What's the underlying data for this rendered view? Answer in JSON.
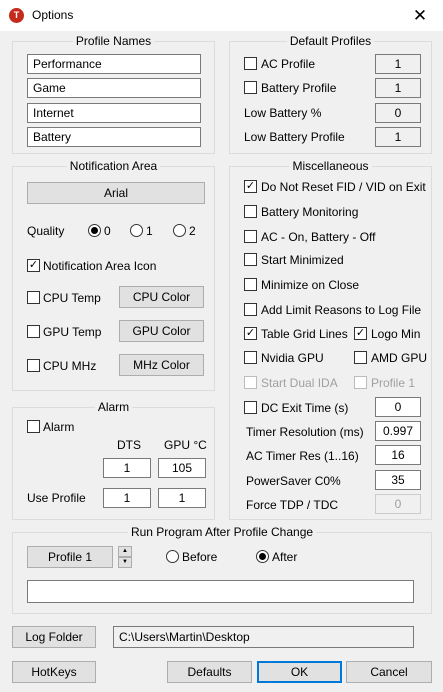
{
  "window": {
    "title": "Options",
    "icon_letter": "T"
  },
  "profile_names": {
    "title": "Profile Names",
    "names": [
      "Performance",
      "Game",
      "Internet",
      "Battery"
    ]
  },
  "default_profiles": {
    "title": "Default Profiles",
    "ac_profile": {
      "label": "AC Profile",
      "checked": false,
      "value": "1"
    },
    "battery_profile": {
      "label": "Battery Profile",
      "checked": false,
      "value": "1"
    },
    "low_battery_pct": {
      "label": "Low Battery %",
      "value": "0"
    },
    "low_battery_profile": {
      "label": "Low Battery Profile",
      "value": "1"
    }
  },
  "notification_area": {
    "title": "Notification Area",
    "font_button": "Arial",
    "quality_label": "Quality",
    "quality_options": [
      "0",
      "1",
      "2"
    ],
    "quality_selected": "0",
    "icon_checkbox": "Notification Area Icon",
    "cpu_temp": "CPU Temp",
    "cpu_color": "CPU Color",
    "gpu_temp": "GPU Temp",
    "gpu_color": "GPU Color",
    "cpu_mhz": "CPU MHz",
    "mhz_color": "MHz Color"
  },
  "misc": {
    "title": "Miscellaneous",
    "do_not_reset": "Do Not Reset FID / VID on Exit",
    "battery_monitoring": "Battery Monitoring",
    "ac_on_battery_off": "AC - On, Battery - Off",
    "start_minimized": "Start Minimized",
    "minimize_on_close": "Minimize on Close",
    "add_limit_reasons": "Add Limit Reasons to Log File",
    "table_grid_lines": "Table Grid Lines",
    "logo_min": "Logo Min",
    "nvidia_gpu": "Nvidia GPU",
    "amd_gpu": "AMD GPU",
    "start_dual_ida": "Start Dual IDA",
    "profile_1": "Profile 1",
    "dc_exit_time": {
      "label": "DC Exit Time (s)",
      "value": "0"
    },
    "timer_resolution": {
      "label": "Timer Resolution (ms)",
      "value": "0.997"
    },
    "ac_timer_res": {
      "label": "AC Timer Res (1..16)",
      "value": "16"
    },
    "powersaver": {
      "label": "PowerSaver C0%",
      "value": "35"
    },
    "force_tdp": {
      "label": "Force TDP / TDC",
      "value": "0"
    }
  },
  "alarm": {
    "title": "Alarm",
    "alarm_label": "Alarm",
    "dts_header": "DTS",
    "gpu_header": "GPU °C",
    "dts_value": "1",
    "gpu_value": "105",
    "use_profile_label": "Use Profile",
    "use_profile_dts": "1",
    "use_profile_gpu": "1"
  },
  "run_program": {
    "title": "Run Program After Profile Change",
    "profile_button": "Profile 1",
    "before": "Before",
    "after": "After",
    "selected": "After",
    "program_path": ""
  },
  "log_folder": {
    "button": "Log Folder",
    "path": "C:\\Users\\Martin\\Desktop"
  },
  "footer": {
    "hotkeys": "HotKeys",
    "defaults": "Defaults",
    "ok": "OK",
    "cancel": "Cancel"
  },
  "colors": {
    "accent": "#0078d7",
    "app_icon": "#c42b1c",
    "window_bg": "#f0f0f0"
  }
}
